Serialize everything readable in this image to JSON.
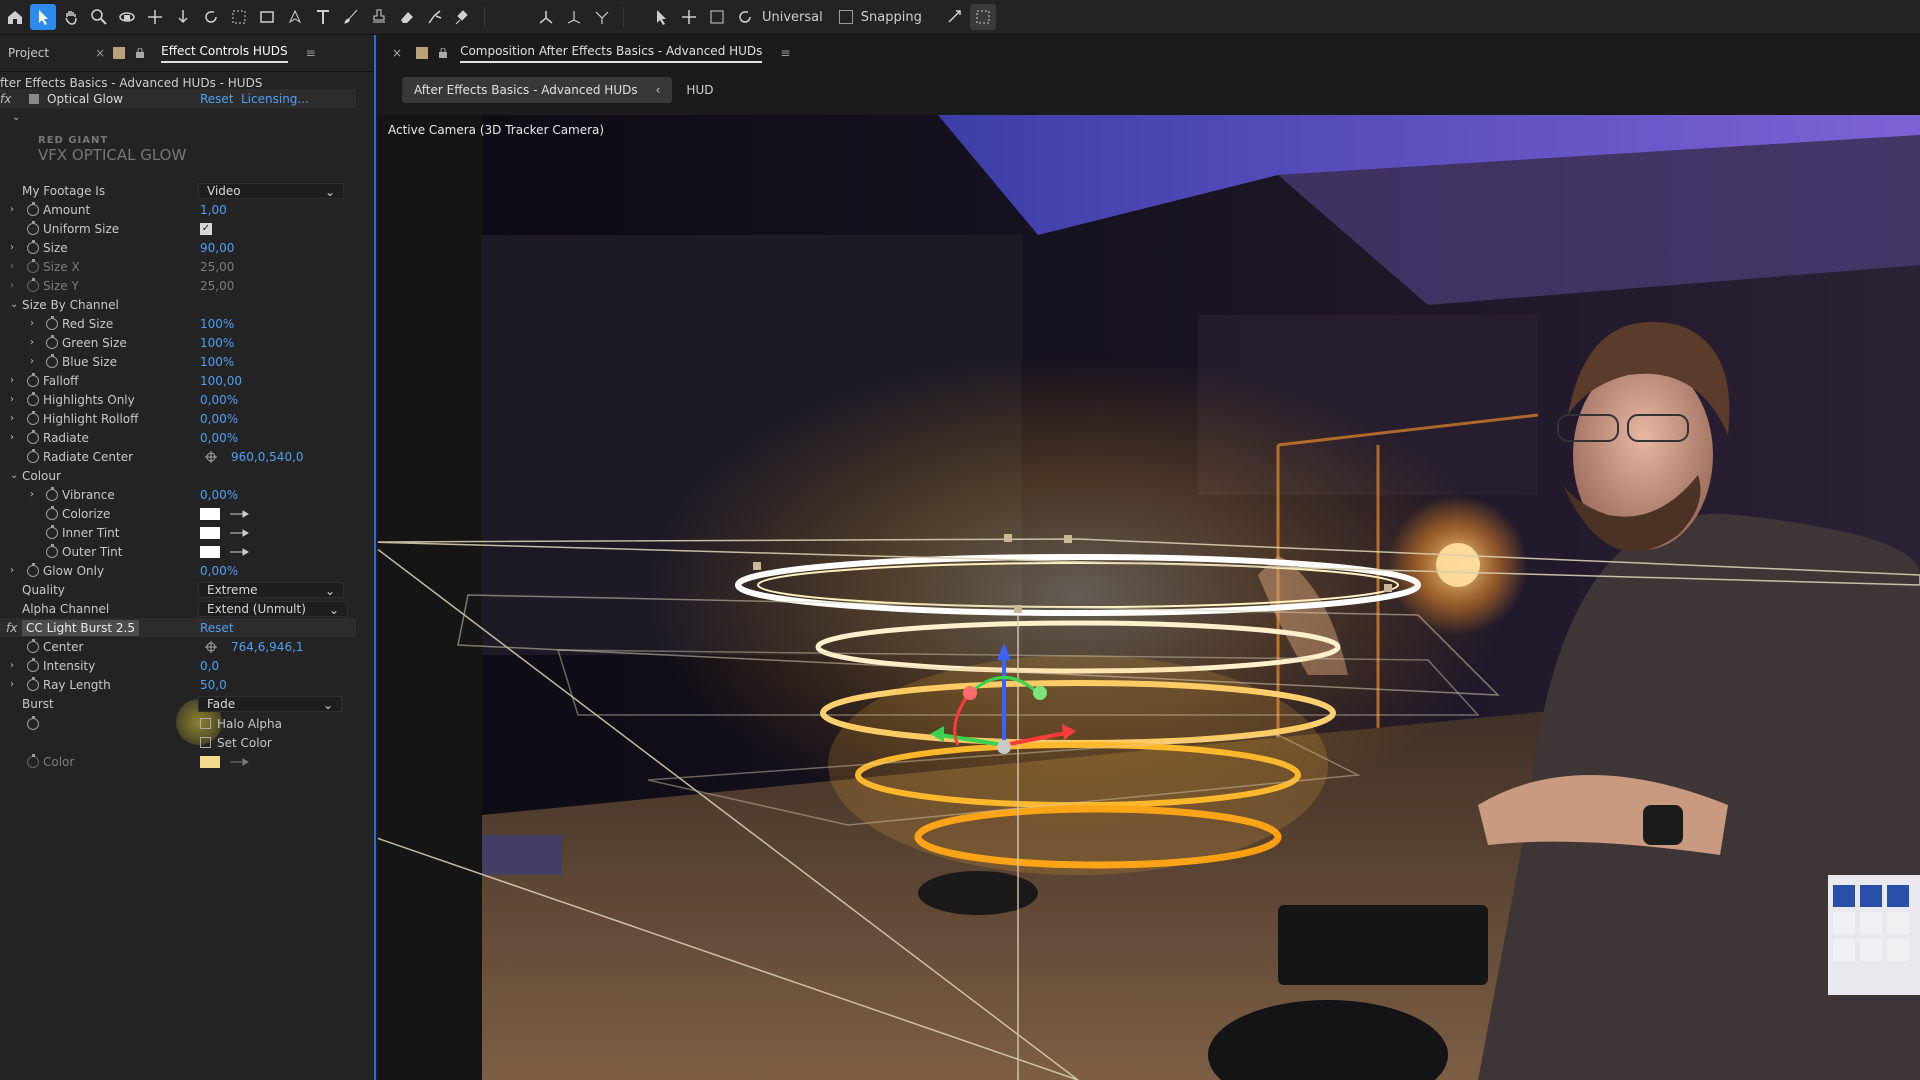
{
  "toolbar": {
    "axis_mode": "Universal",
    "snapping_label": "Snapping"
  },
  "left_panel": {
    "project_tab": "Project",
    "effect_tab": "Effect Controls HUDS",
    "breadcrumb": "fter Effects Basics - Advanced HUDs - HUDS",
    "optical_glow": {
      "name": "Optical Glow",
      "reset": "Reset",
      "licensing": "Licensing...",
      "brand_line1": "RED GIANT",
      "brand_line2": "VFX OPTICAL GLOW"
    },
    "props": [
      {
        "label": "My Footage Is",
        "value": "Video",
        "kind": "dropdown"
      },
      {
        "label": "Amount",
        "value": "1,00"
      },
      {
        "label": "Uniform Size",
        "value": "",
        "kind": "checkbox"
      },
      {
        "label": "Size",
        "value": "90,00"
      },
      {
        "label": "Size X",
        "value": "25,00",
        "dim": true
      },
      {
        "label": "Size Y",
        "value": "25,00",
        "dim": true
      },
      {
        "label": "Size By Channel",
        "value": "",
        "kind": "group"
      },
      {
        "label": "Red Size",
        "value": "100%"
      },
      {
        "label": "Green Size",
        "value": "100%"
      },
      {
        "label": "Blue Size",
        "value": "100%"
      },
      {
        "label": "Falloff",
        "value": "100,00"
      },
      {
        "label": "Highlights Only",
        "value": "0,00%"
      },
      {
        "label": "Highlight Rolloff",
        "value": "0,00%"
      },
      {
        "label": "Radiate",
        "value": "0,00%"
      },
      {
        "label": "Radiate Center",
        "value": "960,0,540,0"
      },
      {
        "label": "Colour",
        "value": "",
        "kind": "group"
      },
      {
        "label": "Vibrance",
        "value": "0,00%"
      },
      {
        "label": "Colorize",
        "value": ""
      },
      {
        "label": "Inner Tint",
        "value": ""
      },
      {
        "label": "Outer Tint",
        "value": ""
      },
      {
        "label": "Glow Only",
        "value": "0,00%"
      },
      {
        "label": "Quality",
        "value": "Extreme"
      },
      {
        "label": "Alpha Channel",
        "value": "Extend (Unmult)"
      }
    ],
    "light_burst": {
      "name": "CC Light Burst 2.5",
      "reset": "Reset",
      "center_label": "Center",
      "center_value": "764,6,946,1",
      "intensity_label": "Intensity",
      "intensity_value": "0,0",
      "ray_label": "Ray Length",
      "ray_value": "50,0",
      "burst_label": "Burst",
      "burst_value": "Fade",
      "halo_alpha": "Halo Alpha",
      "set_color": "Set Color",
      "color_label": "Color"
    }
  },
  "right_panel": {
    "comp_tab": "Composition After Effects Basics - Advanced HUDs",
    "sub_tab": "After Effects Basics - Advanced HUDs",
    "hud_label": "HUD",
    "camera_label": "Active Camera (3D Tracker Camera)"
  },
  "colors": {
    "accent": "#2d8ceb",
    "value_blue": "#4e9ff5"
  }
}
